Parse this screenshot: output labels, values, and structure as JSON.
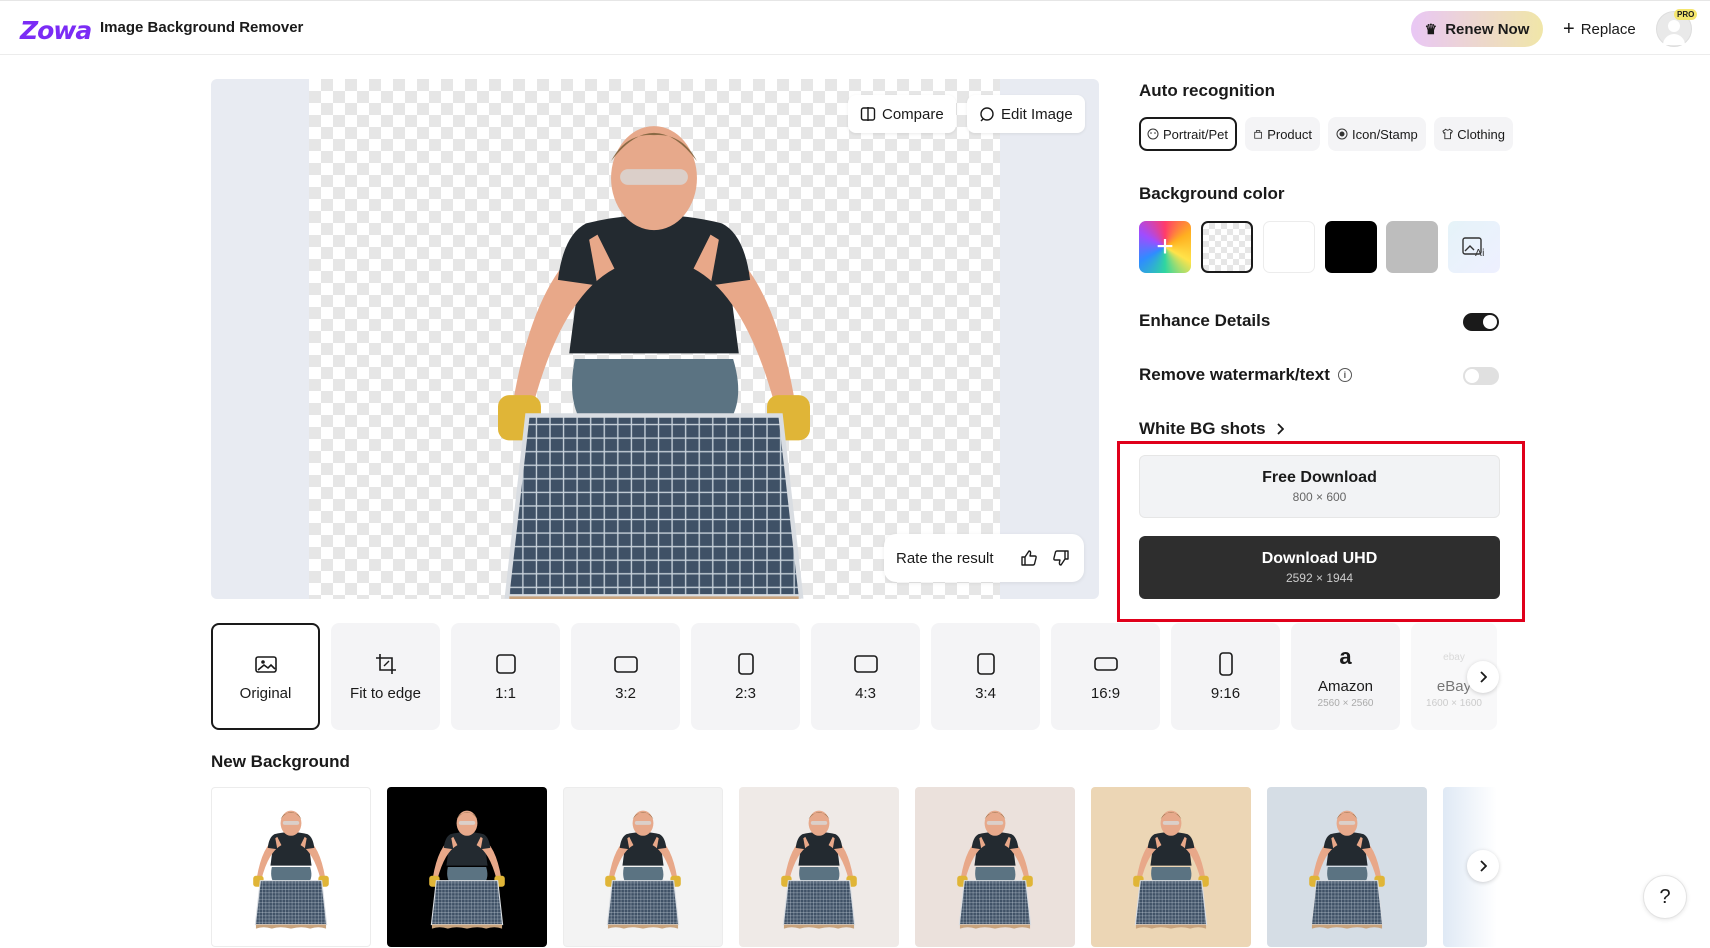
{
  "header": {
    "logo": "Zowa",
    "title": "Image Background Remover",
    "renew_label": "Renew Now",
    "replace_label": "Replace",
    "pro_badge": "PRO"
  },
  "preview": {
    "compare_label": "Compare",
    "edit_label": "Edit Image",
    "rate_label": "Rate the result"
  },
  "auto_recognition": {
    "heading": "Auto recognition",
    "chips": [
      {
        "label": "Portrait/Pet",
        "icon": "portrait-icon",
        "active": true
      },
      {
        "label": "Product",
        "icon": "product-icon",
        "active": false
      },
      {
        "label": "Icon/Stamp",
        "icon": "stamp-icon",
        "active": false
      },
      {
        "label": "Clothing",
        "icon": "clothing-icon",
        "active": false
      }
    ]
  },
  "background_color": {
    "heading": "Background color",
    "swatches": [
      {
        "name": "custom-color",
        "color": "gradient"
      },
      {
        "name": "transparent",
        "color": "checker",
        "selected": true
      },
      {
        "name": "white",
        "color": "#ffffff"
      },
      {
        "name": "black",
        "color": "#000000"
      },
      {
        "name": "gray",
        "color": "#bdbdbd"
      },
      {
        "name": "ai-background",
        "color": "#e8f1fb"
      }
    ]
  },
  "enhance_details": {
    "label": "Enhance Details",
    "on": true
  },
  "remove_watermark": {
    "label": "Remove watermark/text",
    "on": false
  },
  "white_bg_shots": {
    "label": "White BG shots"
  },
  "downloads": {
    "free": {
      "title": "Free Download",
      "size": "800 × 600"
    },
    "uhd": {
      "title": "Download UHD",
      "size": "2592 × 1944"
    }
  },
  "aspects": [
    {
      "label": "Original",
      "icon": "image-icon",
      "active": true
    },
    {
      "label": "Fit to edge",
      "icon": "crop-icon"
    },
    {
      "label": "1:1",
      "icon": "square-icon"
    },
    {
      "label": "3:2",
      "icon": "landscape-icon"
    },
    {
      "label": "2:3",
      "icon": "portrait-ratio-icon"
    },
    {
      "label": "4:3",
      "icon": "landscape-icon"
    },
    {
      "label": "3:4",
      "icon": "portrait-ratio-icon"
    },
    {
      "label": "16:9",
      "icon": "wide-icon"
    },
    {
      "label": "9:16",
      "icon": "tall-icon"
    },
    {
      "label": "Amazon",
      "sub": "2560 × 2560",
      "icon": "amazon-icon",
      "glyph": "a"
    },
    {
      "label": "eBay",
      "sub": "1600 × 1600",
      "icon": "ebay-icon",
      "glyph": "ebay"
    }
  ],
  "new_background": {
    "heading": "New Background",
    "tiles": [
      {
        "name": "white",
        "color": "#ffffff"
      },
      {
        "name": "black",
        "color": "#000000"
      },
      {
        "name": "light-gray",
        "color": "#f3f3f3"
      },
      {
        "name": "warm-gray",
        "color": "#efeae7"
      },
      {
        "name": "beige",
        "color": "#ebe1dc"
      },
      {
        "name": "tan",
        "color": "#ecd6b5"
      },
      {
        "name": "blue-gray",
        "color": "#d5dde5"
      },
      {
        "name": "gradient",
        "color": "#dfe9f5"
      }
    ]
  },
  "help_label": "?"
}
